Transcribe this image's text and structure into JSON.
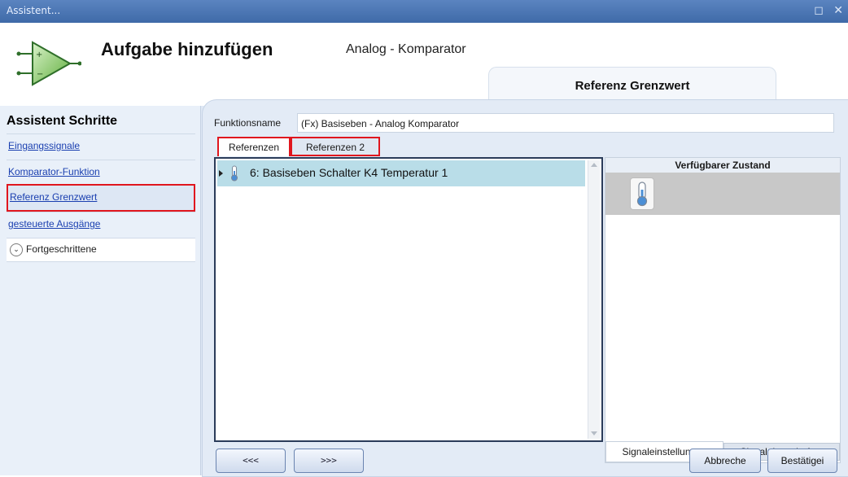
{
  "window": {
    "title": "Assistent...",
    "controls": "◻ ✕"
  },
  "header": {
    "title": "Aufgabe hinzufügen",
    "subtitle": "Analog - Komparator",
    "step_tab": "Referenz Grenzwert",
    "icon": "comparator-icon"
  },
  "sidebar": {
    "heading": "Assistent Schritte",
    "items": [
      {
        "label": "Eingangssignale"
      },
      {
        "label": "Komparator-Funktion"
      },
      {
        "label": "Referenz Grenzwert",
        "selected": true
      },
      {
        "label": "gesteuerte Ausgänge"
      }
    ],
    "advanced": {
      "label": "Fortgeschrittene",
      "icon": "chevron-down-icon"
    }
  },
  "form": {
    "function_name_label": "Funktionsname",
    "function_name_value": "(Fx) Basiseben - Analog Komparator"
  },
  "tabs": [
    {
      "label": "Referenzen",
      "active": true
    },
    {
      "label": "Referenzen 2"
    }
  ],
  "references": [
    {
      "label": "6: Basiseben Schalter K4 Temperatur 1",
      "icon": "thermometer-icon"
    }
  ],
  "right_panel": {
    "heading": "Verfügbarer Zustand",
    "state_icon": "thermometer-icon",
    "tabs": [
      "Signaleinstellungen",
      "Signaleigenchaften"
    ]
  },
  "buttons": {
    "back": "<<<",
    "next": ">>>",
    "cancel": "Abbreche",
    "confirm": "Bestätigei"
  },
  "colors": {
    "highlight": "#e0161e",
    "selected_row": "#b9dde8",
    "titlebar": "#4a73b2",
    "link": "#1a3fb0"
  }
}
